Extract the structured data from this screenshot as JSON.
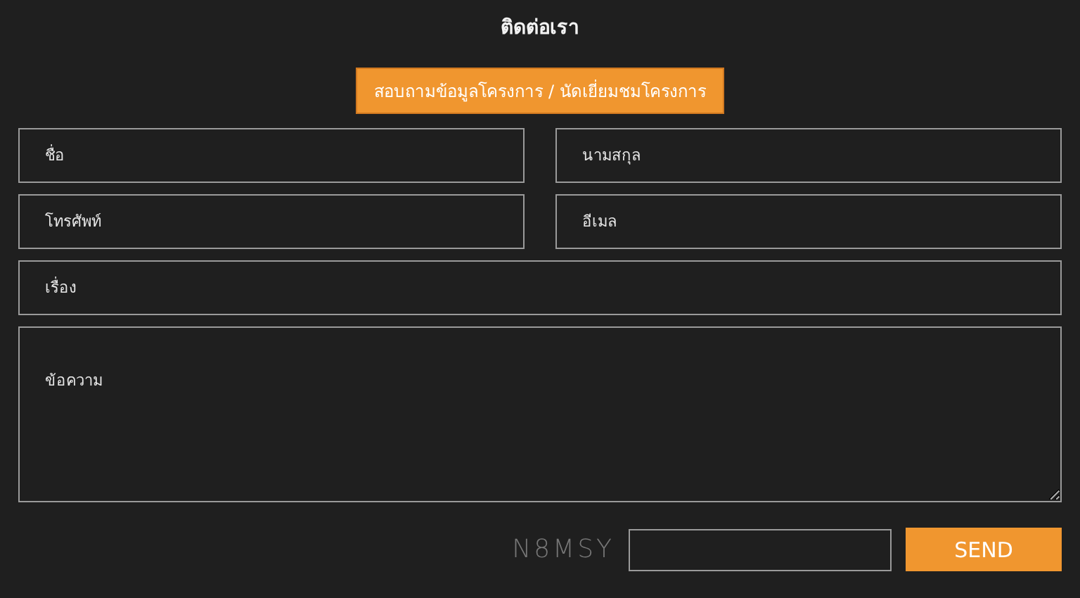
{
  "title": "ติดต่อเรา",
  "tabs": [
    {
      "label": "สอบถามข้อมูลโครงการ / นัดเยี่ยมชมโครงการ",
      "selected": true
    }
  ],
  "fields": [
    {
      "kind": "half",
      "placeholder": "ชื่อ"
    },
    {
      "kind": "half",
      "placeholder": "นามสกุล"
    },
    {
      "kind": "half",
      "placeholder": "โทรศัพท์"
    },
    {
      "kind": "half",
      "placeholder": "อีเมล"
    },
    {
      "kind": "full",
      "placeholder": "เรื่อง"
    },
    {
      "kind": "multiline",
      "placeholder": "ข้อความ"
    }
  ],
  "captcha": {
    "code": "N8MSY"
  },
  "send_button": "SEND"
}
